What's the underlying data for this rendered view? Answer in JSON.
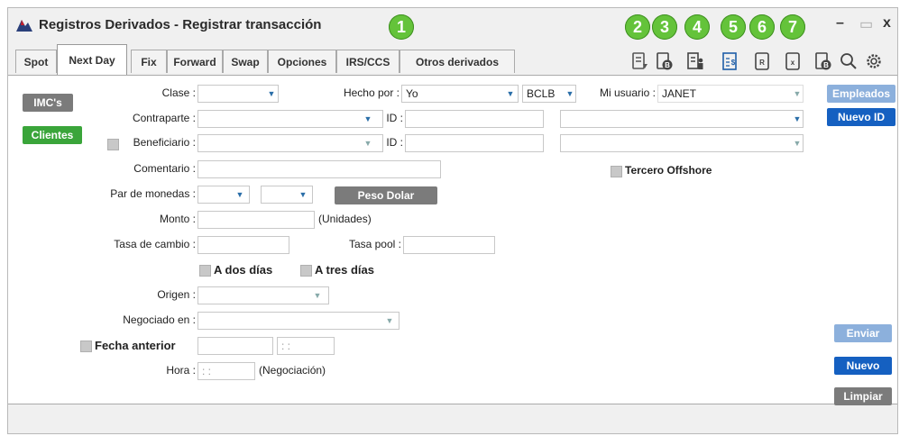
{
  "window": {
    "title": "Registros Derivados - Registrar transacción",
    "controls": {
      "minimize": "–",
      "maximize": "▭",
      "close": "x"
    }
  },
  "badges": [
    "1",
    "2",
    "3",
    "4",
    "5",
    "6",
    "7"
  ],
  "tabs": [
    {
      "label": "Spot"
    },
    {
      "label": "Next Day",
      "active": true
    },
    {
      "label": "Fix"
    },
    {
      "label": "Forward"
    },
    {
      "label": "Swap"
    },
    {
      "label": "Opciones"
    },
    {
      "label": "IRS/CCS"
    },
    {
      "label": "Otros derivados"
    }
  ],
  "toolbar": {
    "icons": [
      "document-lines-icon",
      "document-b-icon",
      "document-user-icon",
      "document-dollar-icon",
      "document-r-icon",
      "document-x-icon",
      "document-b-alt-icon",
      "search-icon",
      "gear-icon"
    ]
  },
  "buttons": {
    "imcs": "IMC's",
    "clientes": "Clientes",
    "peso_dolar": "Peso Dolar",
    "empleados": "Empleados",
    "nuevo_id": "Nuevo ID",
    "enviar": "Enviar",
    "nuevo": "Nuevo",
    "limpiar": "Limpiar"
  },
  "form": {
    "clase_label": "Clase :",
    "hecho_por_label": "Hecho por :",
    "hecho_por_value": "Yo",
    "bclb_value": "BCLB",
    "mi_usuario_label": "Mi usuario :",
    "mi_usuario_value": "JANET",
    "contraparte_label": "Contraparte :",
    "id_label": "ID :",
    "beneficiario_label": "Beneficiario :",
    "comentario_label": "Comentario :",
    "tercero_offshore_label": "Tercero Offshore",
    "par_monedas_label": "Par de monedas :",
    "monto_label": "Monto :",
    "unidades_label": "(Unidades)",
    "tasa_cambio_label": "Tasa de cambio :",
    "tasa_pool_label": "Tasa pool :",
    "a_dos_dias_label": "A dos días",
    "a_tres_dias_label": "A tres días",
    "origen_label": "Origen :",
    "negociado_en_label": "Negociado en :",
    "fecha_anterior_label": "Fecha anterior",
    "fecha_time_placeholder": ": :",
    "hora_label": "Hora :",
    "hora_value": ": :",
    "negociacion_label": "(Negociación)"
  },
  "colors": {
    "badge": "#64c33a",
    "primary_button": "#1560c1",
    "green_button": "#3aa53a",
    "gray_button": "#7b7b7b"
  }
}
